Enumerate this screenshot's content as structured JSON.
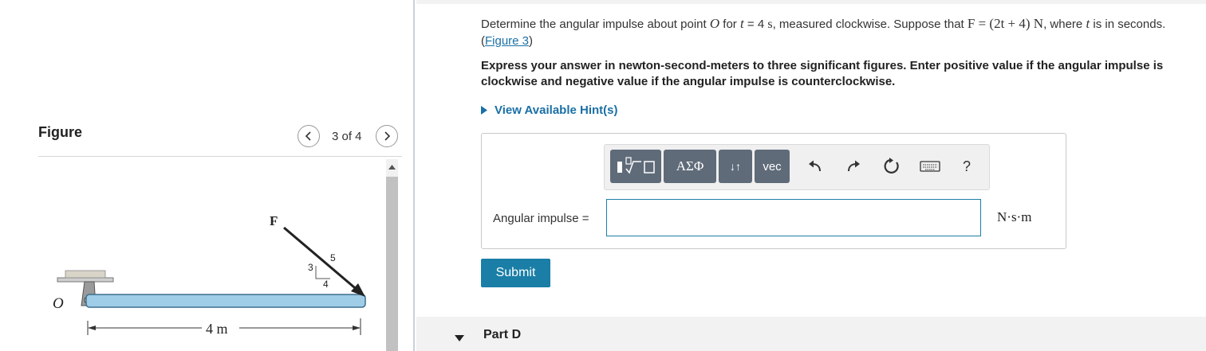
{
  "figure": {
    "title": "Figure",
    "counter": "3 of 4",
    "labels": {
      "force": "F",
      "point": "O",
      "slope_3": "3",
      "slope_4": "4",
      "slope_5": "5",
      "length": "4 m"
    }
  },
  "question": {
    "text_pre": "Determine the angular impulse about point",
    "point": "O",
    "text_for": "for",
    "t_var": "t",
    "t_value": "= 4",
    "t_unit": "s",
    "text_measured": ", measured clockwise. Suppose that",
    "force_expr": "F = (2t + 4) N",
    "text_where": ", where",
    "text_tail": "is in seconds.",
    "figure_link": "Figure 3",
    "instructions": "Express your answer in newton-second-meters to three significant figures. Enter positive value if the angular impulse is clockwise and negative value if the angular impulse is counterclockwise."
  },
  "hint_label": "View Available Hint(s)",
  "toolbar": {
    "templates_icon": "templates-icon",
    "greek_label": "ΑΣΦ",
    "arrows_label": "↓↑",
    "vec_label": "vec",
    "help_label": "?"
  },
  "answer": {
    "label": "Angular impulse =",
    "value": "",
    "unit": "N·s·m"
  },
  "submit_label": "Submit",
  "next_part": "Part D",
  "colors": {
    "link": "#1a70a6",
    "submit": "#1a7ea6",
    "toolbar_btn": "#5f6b79",
    "beam": "#9fcde8"
  }
}
